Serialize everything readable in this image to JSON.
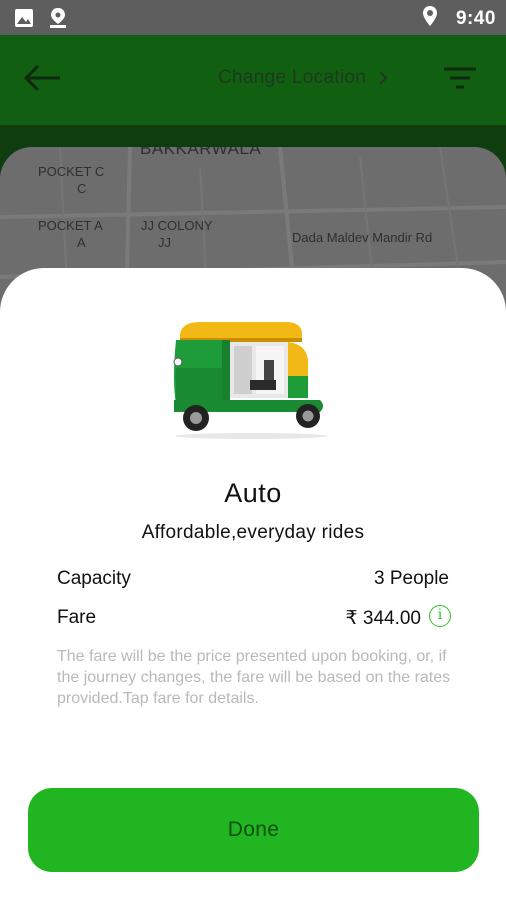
{
  "status_bar": {
    "time": "9:40",
    "icons": [
      "image-icon",
      "location-app-icon",
      "location-pin-icon"
    ]
  },
  "header": {
    "change_location_label": "Change Location",
    "back_icon": "arrow-left-icon",
    "chevron_icon": "chevron-right-icon",
    "filter_icon": "filter-icon"
  },
  "map": {
    "labels": [
      "BAKKARWALA",
      "POCKET C",
      "C",
      "POCKET A",
      "A",
      "JJ COLONY",
      "JJ",
      "Dada Maldev Mandir Rd"
    ]
  },
  "ride": {
    "name": "Auto",
    "tagline": "Affordable,everyday rides",
    "capacity_label": "Capacity",
    "capacity_value": "3 People",
    "fare_label": "Fare",
    "fare_value": "₹ 344.00",
    "info_icon": "info-icon",
    "fare_note": "The fare will be the price presented upon booking, or, if the journey changes, the fare will be based on the rates provided.Tap fare for details.",
    "done_label": "Done"
  },
  "colors": {
    "brand_green": "#22b522",
    "info_green": "#2bbf2b",
    "header_dimmed": "#115f11"
  }
}
